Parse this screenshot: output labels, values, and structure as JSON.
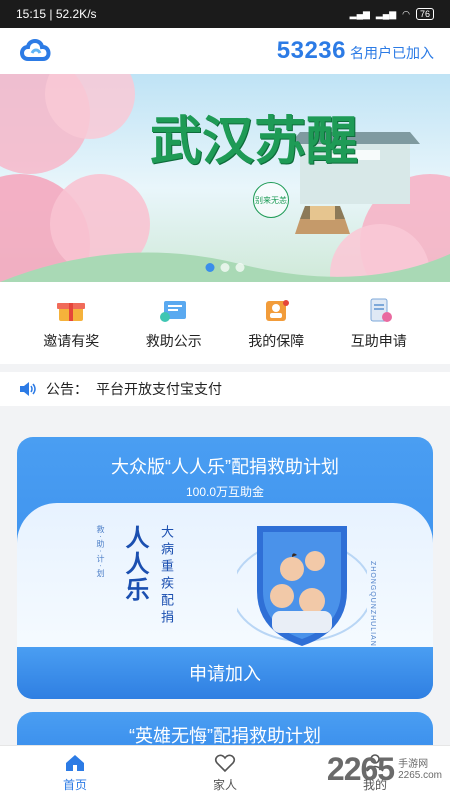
{
  "status": {
    "time": "15:15",
    "speed": "52.2K/s",
    "battery": "76"
  },
  "header": {
    "user_count": "53236",
    "user_count_suffix": "名用户已加入",
    "logo_icon": "cloud-logo-icon"
  },
  "banner": {
    "title": "武汉苏醒",
    "stamp": "别来无恙",
    "active_slide": 0,
    "slides": 3
  },
  "quick_nav": [
    {
      "label": "邀请有奖",
      "icon": "gift-icon"
    },
    {
      "label": "救助公示",
      "icon": "announcement-icon"
    },
    {
      "label": "我的保障",
      "icon": "shield-person-icon"
    },
    {
      "label": "互助申请",
      "icon": "application-icon"
    }
  ],
  "notice": {
    "label": "公告：",
    "text": "平台开放支付宝支付",
    "icon": "speaker-icon"
  },
  "plan_card_1": {
    "title": "大众版“人人乐”配捐救助计划",
    "subtitle": "100.0万互助金",
    "big_text": "人人乐",
    "vertical_text": "大病重疾配捐",
    "small_text": "救·助·计·划",
    "english_text": "ZHONGQUNZHULIAN",
    "apply_label": "申请加入"
  },
  "plan_card_2": {
    "title": "“英雄无悔”配捐救助计划"
  },
  "tabbar": [
    {
      "label": "首页",
      "icon": "home-icon",
      "active": true
    },
    {
      "label": "家人",
      "icon": "heart-icon",
      "active": false
    },
    {
      "label": "我的",
      "icon": "person-icon",
      "active": false
    }
  ],
  "watermark": {
    "number": "2265",
    "text_top": "手游网",
    "text_bottom": "2265.com"
  },
  "colors": {
    "accent": "#2c7be5",
    "card_blue": "#3a8eea"
  }
}
